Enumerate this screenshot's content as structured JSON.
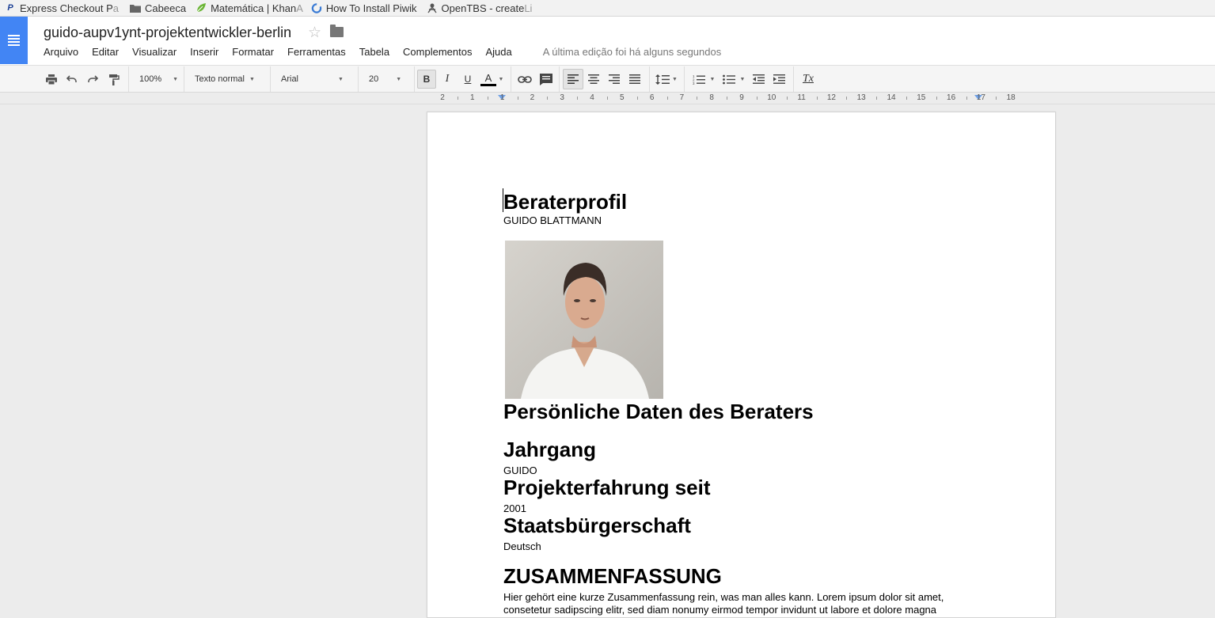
{
  "bookmarks": [
    {
      "label": "Express Checkout P",
      "fade": "a",
      "icon": "paypal-icon"
    },
    {
      "label": "Cabeeca",
      "fade": "",
      "icon": "folder-icon"
    },
    {
      "label": "Matemática | Khan ",
      "fade": "A",
      "icon": "leaf-icon"
    },
    {
      "label": "How To Install Piwik",
      "fade": "",
      "icon": "piwik-icon"
    },
    {
      "label": "OpenTBS - create ",
      "fade": "Li",
      "icon": "opentbs-icon"
    }
  ],
  "header": {
    "title": "guido-aupv1ynt-projektentwickler-berlin",
    "menu": [
      "Arquivo",
      "Editar",
      "Visualizar",
      "Inserir",
      "Formatar",
      "Ferramentas",
      "Tabela",
      "Complementos",
      "Ajuda"
    ],
    "last_edit": "A última edição foi há alguns segundos"
  },
  "toolbar": {
    "zoom": "100%",
    "style": "Texto normal",
    "font": "Arial",
    "size": "20",
    "bold": "B",
    "italic": "I",
    "underline": "U",
    "text_color_letter": "A",
    "text_color": "#000000",
    "clear_format": "Tx"
  },
  "ruler": {
    "numbers": [
      "2",
      "1",
      "1",
      "2",
      "3",
      "4",
      "5",
      "6",
      "7",
      "8",
      "9",
      "10",
      "11",
      "12",
      "13",
      "14",
      "15",
      "16",
      "17",
      "18"
    ]
  },
  "document": {
    "title": "Beraterprofil",
    "name": "GUIDO BLATTMANN",
    "section_personal": "Persönliche Daten des Beraters",
    "jahrgang_label": "Jahrgang",
    "jahrgang_value": "GUIDO",
    "projekt_label": "Projekterfahrung seit",
    "projekt_value": "2001",
    "staats_label": "Staatsbürgerschaft",
    "staats_value": "Deutsch",
    "summary_label": "ZUSAMMENFASSUNG",
    "summary_line1": "Hier gehört eine kurze Zusammenfassung rein, was man alles kann. Lorem ipsum dolor sit amet,",
    "summary_line2": "consetetur sadipscing elitr, sed diam nonumy eirmod tempor invidunt ut labore et dolore magna"
  },
  "colors": {
    "brand": "#4285f4",
    "ruler_marker": "#6fa0e6"
  }
}
